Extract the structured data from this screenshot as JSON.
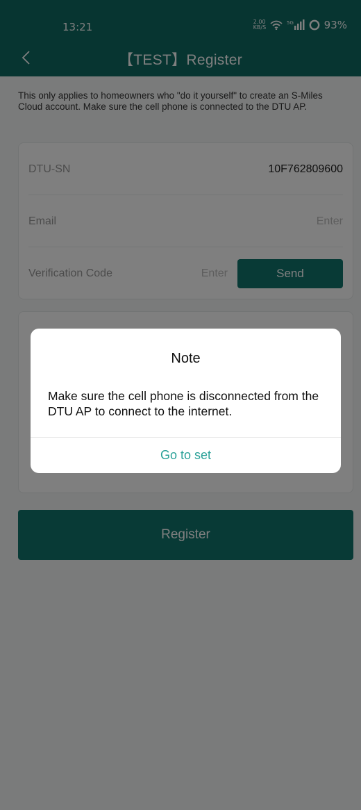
{
  "status_bar": {
    "time": "13:21",
    "speed_value": "2.00",
    "speed_unit": "KB/S",
    "network": "5G",
    "battery": "93%"
  },
  "header": {
    "title": "【TEST】Register",
    "background_color": "#0f6a63"
  },
  "intro_note": "This only applies to homeowners who \"do it yourself\" to create an S-Miles Cloud account. Make sure the cell phone is connected to the DTU AP.",
  "form": {
    "dtu_sn_label": "DTU-SN",
    "dtu_sn_value": "10F762809600",
    "email_label": "Email",
    "email_placeholder": "Enter",
    "code_label": "Verification Code",
    "code_placeholder": "Enter",
    "send_label": "Send"
  },
  "register_label": "Register",
  "dialog": {
    "title": "Note",
    "message": "Make sure the cell phone is disconnected from the DTU AP to connect to the internet.",
    "action_label": "Go to set",
    "action_color": "#2aa198"
  },
  "icons": {
    "back": "chevron-left-icon",
    "wifi": "wifi-icon",
    "signal": "signal-icon",
    "battery": "battery-icon"
  }
}
